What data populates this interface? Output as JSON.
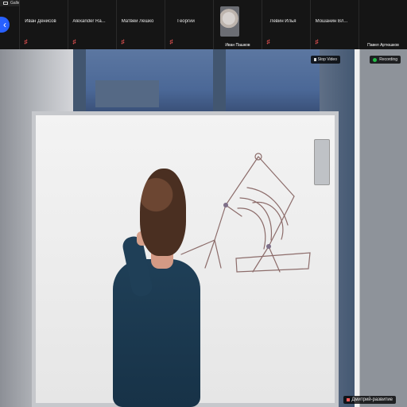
{
  "window": {
    "gallery_view_label": "Gallery View"
  },
  "participants": [
    {
      "name": "Павел Артюшков",
      "kind": "video"
    },
    {
      "name": "Мошанин Вл...",
      "kind": "plain"
    },
    {
      "name": "Левин Илья",
      "kind": "plain"
    },
    {
      "name": "Иван Пашков",
      "kind": "video-cat"
    },
    {
      "name": "Георгий",
      "kind": "plain"
    },
    {
      "name": "Матвей Лешко",
      "kind": "plain"
    },
    {
      "name": "Alexander Ra...",
      "kind": "plain"
    },
    {
      "name": "Иван Денисов",
      "kind": "plain"
    }
  ],
  "main": {
    "recording_label": "Recording",
    "stop_video_label": "Stop Video",
    "speaker_name": "Дмитрий-развитие"
  },
  "colors": {
    "accent": "#2860ff",
    "muted": "#ff5a5a",
    "recording": "#22bb44"
  },
  "icons": {
    "previous": "chevron-left-icon",
    "mute": "mic-off-icon",
    "recording": "recording-dot-icon",
    "stop_video": "video-icon"
  }
}
